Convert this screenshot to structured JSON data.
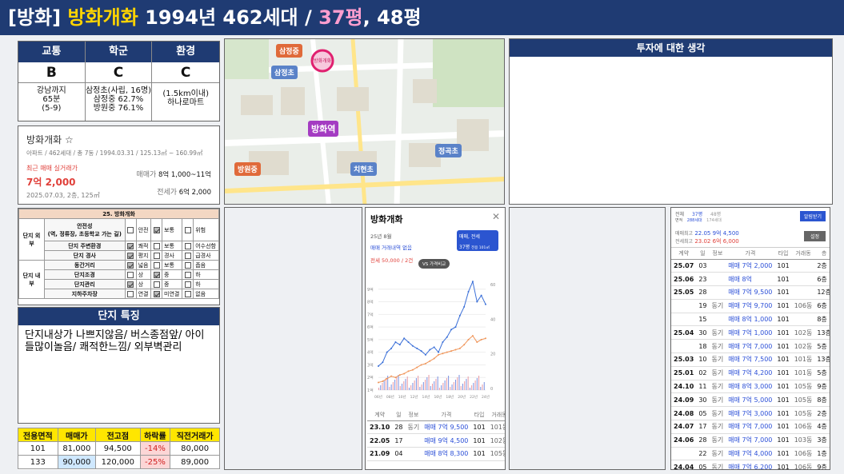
{
  "title": {
    "prefix": "[방화]",
    "name": "방화개화",
    "rest": " 1994년 462세대 / ",
    "size_a": "37평",
    "size_b": ", 48평"
  },
  "summary": {
    "headers": [
      "교통",
      "학군",
      "환경"
    ],
    "grades": [
      "B",
      "C",
      "C"
    ],
    "transport_lines": [
      "강남까지",
      "65분",
      "(5-9)"
    ],
    "school_lines": [
      "삼정초(사립, 16명)",
      "삼정중 62.7%",
      "방원중 76.1%"
    ],
    "env_lines": [
      "(1.5km이내)",
      "하나로마트"
    ]
  },
  "listing": {
    "name": "방화개화 ☆",
    "meta": "아파트 / 462세대 / 총 7동 / 1994.03.31 / 125.13㎡ ~ 160.99㎡",
    "recent_label": "최근 매매 실거래가",
    "recent_price": "7억 2,000",
    "recent_detail": "2025.07.03, 2층, 125㎡",
    "sale_label": "매매가",
    "sale_value": "8억 1,000~11억",
    "jeonse_label": "전세가",
    "jeonse_value": "6억 2,000"
  },
  "env_table": {
    "title": "25. 방화개화",
    "group_outer": "단지 외부",
    "group_inner": "단지 내부",
    "rows": [
      {
        "label": "안전성\n(역, 정류장, 초등학교 가는 길)",
        "opts": [
          "안전",
          "보통",
          "위험"
        ],
        "checked": 1
      },
      {
        "label": "단지 주변환경",
        "opts": [
          "쾌적",
          "보통",
          "어수선함"
        ],
        "checked": 0
      },
      {
        "label": "단지 경사",
        "opts": [
          "평지",
          "경사",
          "급경사"
        ],
        "checked": 0
      },
      {
        "label": "동간거리",
        "opts": [
          "넓음",
          "보통",
          "좁음"
        ],
        "checked": 0
      },
      {
        "label": "단지조경",
        "opts": [
          "상",
          "중",
          "하"
        ],
        "checked": 1
      },
      {
        "label": "단지관리",
        "opts": [
          "상",
          "중",
          "하"
        ],
        "checked": 0
      },
      {
        "label": "지하주차장",
        "opts": [
          "연결",
          "미연결",
          "없음"
        ],
        "checked": 1
      }
    ]
  },
  "features": {
    "heading": "단지 특징",
    "text": "단지내상가 나쁘지않음/ 버스종점앞/ 아이들많이놀음/ 쾌적한느낌/ 외부벽관리"
  },
  "price_table": {
    "headers": [
      "전용면적",
      "매매가",
      "전고점",
      "하락률",
      "직전거래가"
    ],
    "rows": [
      [
        "101",
        "81,000",
        "94,500",
        "-14%",
        "80,000"
      ],
      [
        "133",
        "90,000",
        "120,000",
        "-25%",
        "89,000"
      ]
    ]
  },
  "map": {
    "labels": [
      "삼정중",
      "삼정초",
      "방화역",
      "방원중",
      "치현초",
      "정곡초",
      "방화개화"
    ]
  },
  "invest": {
    "heading": "투자에 대한 생각"
  },
  "chart_popup": {
    "title": "방화개화",
    "month": "25년 8월",
    "no_sale": "매매 거래내역 없음",
    "jeonse": "전세 50,000 / 2건",
    "badge": "매매, 전세",
    "badge_sub": "37평",
    "badge_sub2": "전용 101㎡",
    "compare": "VS 가격비교",
    "headers": [
      "계약",
      "일",
      "정보",
      "가격",
      "타입",
      "거래동",
      "층"
    ],
    "rows": [
      [
        "23.10",
        "28",
        "동기",
        "매매 7억 9,500",
        "101",
        "101동",
        "8층"
      ],
      [
        "22.05",
        "17",
        "",
        "매매 9억 4,500",
        "101",
        "102동",
        "5층"
      ],
      [
        "21.09",
        "04",
        "",
        "매매 8억 8,300",
        "101",
        "105동",
        "6층"
      ]
    ]
  },
  "chart_data": {
    "type": "line",
    "x": [
      "06년",
      "08년",
      "10년",
      "12년",
      "14년",
      "16년",
      "18년",
      "20년",
      "22년",
      "24년"
    ],
    "y_left_ticks": [
      "1억",
      "2억",
      "3억",
      "4억",
      "5억",
      "6억",
      "7억",
      "8억",
      "9억"
    ],
    "y_right_ticks": [
      "0",
      "20",
      "40",
      "60"
    ],
    "ylim": [
      1,
      10
    ],
    "series": [
      {
        "name": "매매",
        "color": "#3a6fd8",
        "values": [
          2.9,
          3.2,
          4.0,
          4.3,
          4.8,
          4.6,
          5.1,
          4.8,
          4.5,
          4.3,
          4.1,
          3.8,
          4.2,
          4.4,
          4.0,
          4.8,
          5.2,
          5.8,
          6.0,
          6.9,
          7.6,
          8.8,
          9.6,
          8.0,
          8.5,
          7.8
        ]
      },
      {
        "name": "전세",
        "color": "#f0965a",
        "values": [
          1.6,
          1.7,
          1.9,
          2.1,
          2.0,
          2.2,
          2.3,
          2.5,
          2.6,
          2.8,
          3.0,
          3.1,
          3.3,
          3.5,
          3.8,
          3.9,
          4.0,
          4.1,
          4.2,
          4.3,
          4.6,
          5.0,
          5.3,
          4.8,
          5.0,
          5.1
        ]
      }
    ]
  },
  "side_panel": {
    "tab_a": "37평",
    "tab_b": "48평",
    "sub_a": "288세대",
    "sub_b": "174세대",
    "size_label": "면적",
    "kind_label": "전체",
    "sale_high_label": "매매최고",
    "sale_high": "22.05 9억 4,500",
    "jeonse_high_label": "전세최고",
    "jeonse_high": "23.02 6억 6,000",
    "btn_alert": "알림받기",
    "btn_setting": "설정",
    "headers": [
      "계약",
      "일",
      "정보",
      "가격",
      "타입",
      "거래동",
      "층"
    ],
    "rows": [
      [
        "25.07",
        "03",
        "",
        "매매 7억 2,000",
        "101",
        "",
        "2층"
      ],
      [
        "25.06",
        "23",
        "",
        "매매 8억",
        "101",
        "",
        "6층"
      ],
      [
        "25.05",
        "28",
        "",
        "매매 7억 9,500",
        "101",
        "",
        "12층"
      ],
      [
        "",
        "19",
        "동기",
        "매매 7억 9,700",
        "101",
        "106동",
        "6층"
      ],
      [
        "",
        "15",
        "",
        "매매 8억 1,000",
        "101",
        "",
        "8층"
      ],
      [
        "25.04",
        "30",
        "동기",
        "매매 7억 1,000",
        "101",
        "102동",
        "13층"
      ],
      [
        "",
        "18",
        "동기",
        "매매 7억 7,000",
        "101",
        "102동",
        "5층"
      ],
      [
        "25.03",
        "10",
        "동기",
        "매매 7억 7,500",
        "101",
        "101동",
        "13층"
      ],
      [
        "25.01",
        "02",
        "동기",
        "매매 7억 4,200",
        "101",
        "101동",
        "5층"
      ],
      [
        "24.10",
        "11",
        "동기",
        "매매 8억 3,000",
        "101",
        "105동",
        "9층"
      ],
      [
        "24.09",
        "30",
        "동기",
        "매매 7억 5,000",
        "101",
        "105동",
        "8층"
      ],
      [
        "24.08",
        "05",
        "동기",
        "매매 7억 3,000",
        "101",
        "105동",
        "2층"
      ],
      [
        "24.07",
        "17",
        "동기",
        "매매 7억 7,000",
        "101",
        "106동",
        "4층"
      ],
      [
        "24.06",
        "28",
        "동기",
        "매매 7억 7,000",
        "101",
        "103동",
        "3층"
      ],
      [
        "",
        "22",
        "동기",
        "매매 7억 4,000",
        "101",
        "106동",
        "1층"
      ],
      [
        "24.04",
        "05",
        "동기",
        "매매 7억 6,200",
        "101",
        "106동",
        "9층"
      ]
    ]
  }
}
